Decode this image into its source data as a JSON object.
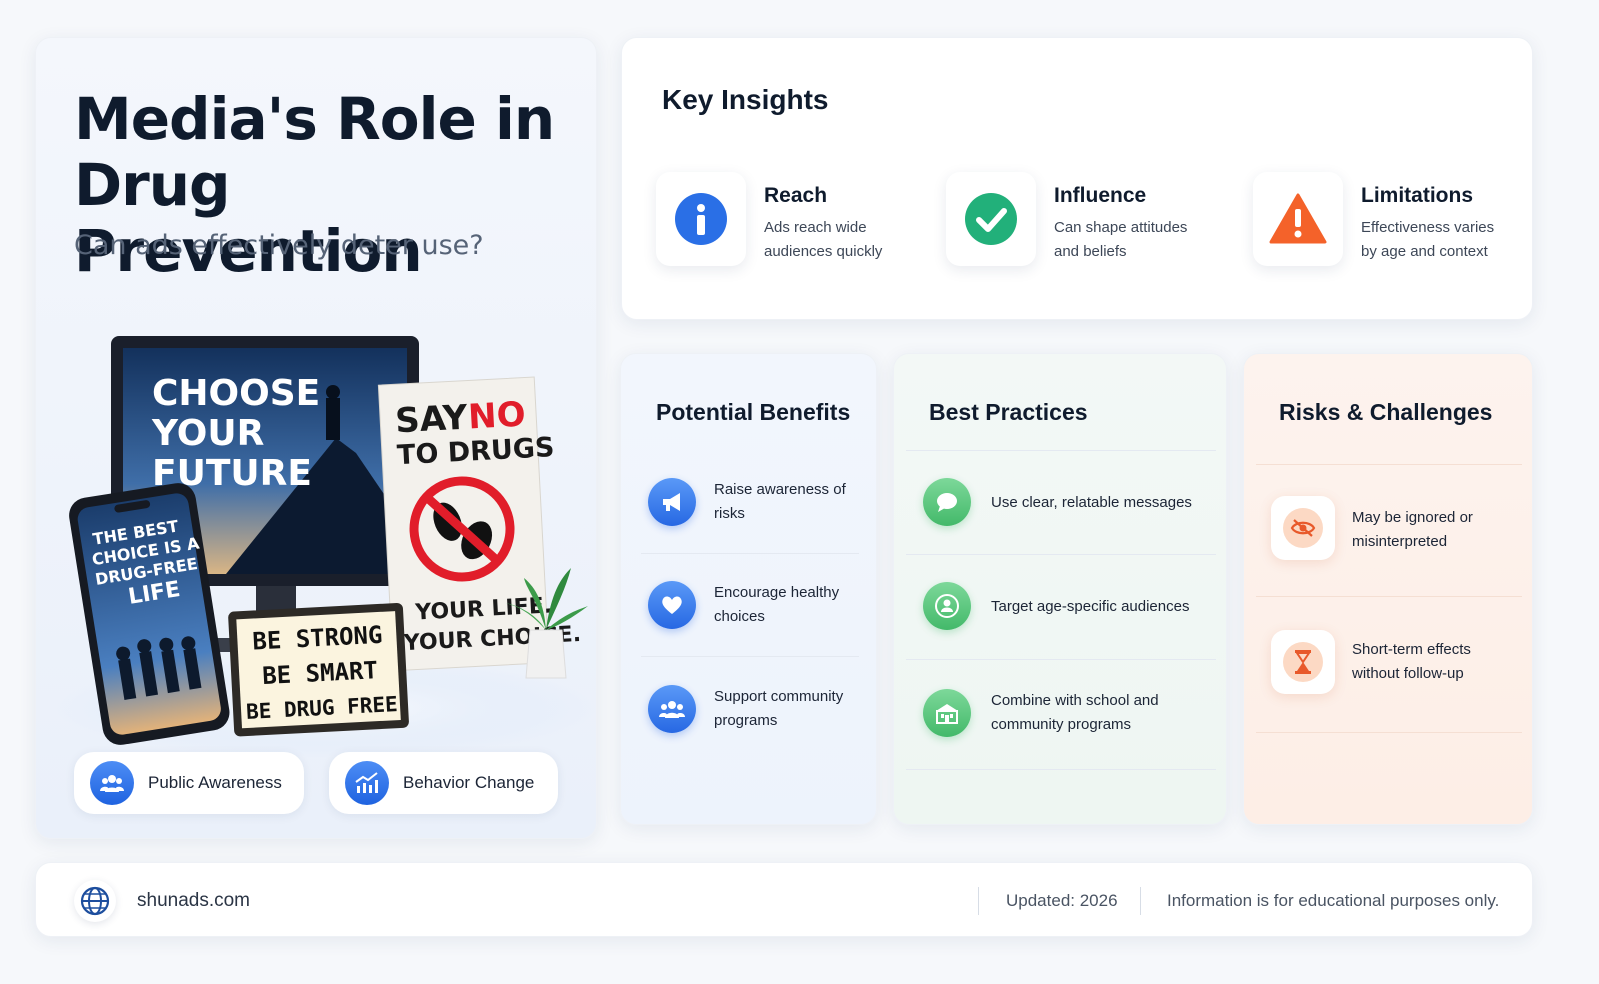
{
  "hero": {
    "title": "Media's Role in Drug Prevention",
    "subtitle": "Can ads effectively deter use?",
    "monitor_text": [
      "CHOOSE",
      "YOUR",
      "FUTURE"
    ],
    "phone_text": [
      "THE BEST",
      "CHOICE IS A",
      "DRUG-FREE",
      "LIFE"
    ],
    "poster_top": "SAY",
    "poster_no": "NO",
    "poster_line2": "TO DRUGS",
    "poster_bottom": [
      "YOUR LIFE.",
      "YOUR CHOICE."
    ],
    "lightbox_text": [
      "BE STRONG",
      "BE SMART",
      "BE DRUG FREE"
    ],
    "pills": [
      {
        "label": "Public Awareness",
        "icon": "people-icon"
      },
      {
        "label": "Behavior Change",
        "icon": "growth-chart-icon"
      }
    ]
  },
  "insights": {
    "title": "Key Insights",
    "items": [
      {
        "title": "Reach",
        "desc": "Ads reach wide audiences quickly",
        "icon": "info-icon",
        "color": "#2a6fe6"
      },
      {
        "title": "Influence",
        "desc": "Can shape attitudes and beliefs",
        "icon": "check-icon",
        "color": "#22b07a"
      },
      {
        "title": "Limitations",
        "desc": "Effectiveness varies by age and context",
        "icon": "warning-icon",
        "color": "#f4622a"
      }
    ]
  },
  "benefits": {
    "title": "Potential Benefits",
    "items": [
      {
        "label": "Raise awareness of risks",
        "icon": "megaphone-icon"
      },
      {
        "label": "Encourage healthy choices",
        "icon": "heart-icon"
      },
      {
        "label": "Support community programs",
        "icon": "community-icon"
      }
    ]
  },
  "practices": {
    "title": "Best Practices",
    "items": [
      {
        "label": "Use clear, relatable messages",
        "icon": "chat-bubble-icon"
      },
      {
        "label": "Target age-specific audiences",
        "icon": "target-person-icon"
      },
      {
        "label": "Combine with school and community programs",
        "icon": "school-icon"
      }
    ]
  },
  "risks": {
    "title": "Risks & Challenges",
    "items": [
      {
        "label": "May be ignored or misinterpreted",
        "icon": "eye-off-icon"
      },
      {
        "label": "Short-term effects without follow-up",
        "icon": "hourglass-icon"
      }
    ]
  },
  "footer": {
    "site": "shunads.com",
    "updated": "Updated: 2026",
    "disclaimer": "Information is for educational purposes only."
  }
}
